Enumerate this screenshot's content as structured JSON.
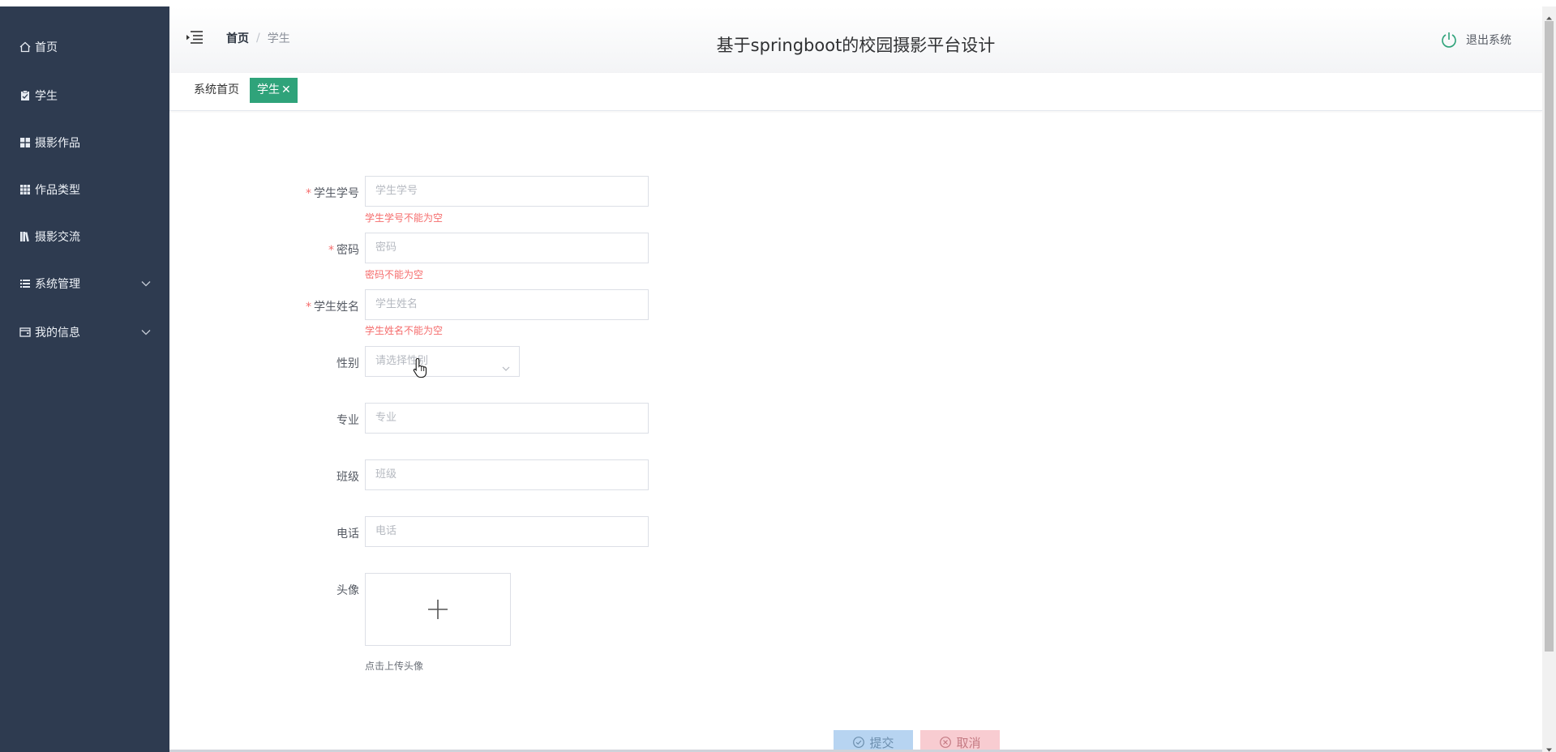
{
  "sidebar": {
    "items": [
      {
        "label": "首页",
        "icon": "home-icon"
      },
      {
        "label": "学生",
        "icon": "clipboard-icon"
      },
      {
        "label": "摄影作品",
        "icon": "grid-icon"
      },
      {
        "label": "作品类型",
        "icon": "apps-icon"
      },
      {
        "label": "摄影交流",
        "icon": "library-icon"
      },
      {
        "label": "系统管理",
        "icon": "list-icon",
        "expandable": true
      },
      {
        "label": "我的信息",
        "icon": "wallet-icon",
        "expandable": true
      }
    ]
  },
  "header": {
    "breadcrumb_home": "首页",
    "breadcrumb_sep": "/",
    "breadcrumb_current": "学生",
    "title": "基于springboot的校园摄影平台设计",
    "logout_label": "退出系统"
  },
  "tabs": {
    "home_tab": "系统首页",
    "active_tab": "学生",
    "close_glyph": "✕"
  },
  "form": {
    "student_id": {
      "label": "学生学号",
      "placeholder": "学生学号",
      "error": "学生学号不能为空",
      "required": true
    },
    "password": {
      "label": "密码",
      "placeholder": "密码",
      "error": "密码不能为空",
      "required": true
    },
    "student_name": {
      "label": "学生姓名",
      "placeholder": "学生姓名",
      "error": "学生姓名不能为空",
      "required": true
    },
    "gender": {
      "label": "性别",
      "placeholder": "请选择性别"
    },
    "major": {
      "label": "专业",
      "placeholder": "专业"
    },
    "class": {
      "label": "班级",
      "placeholder": "班级"
    },
    "phone": {
      "label": "电话",
      "placeholder": "电话"
    },
    "avatar": {
      "label": "头像",
      "hint": "点击上传头像"
    },
    "required_mark": "*",
    "submit_label": "提交",
    "cancel_label": "取消"
  },
  "colors": {
    "sidebar_bg": "#2e3b50",
    "accent": "#2fa37a",
    "error": "#f56c6c"
  }
}
